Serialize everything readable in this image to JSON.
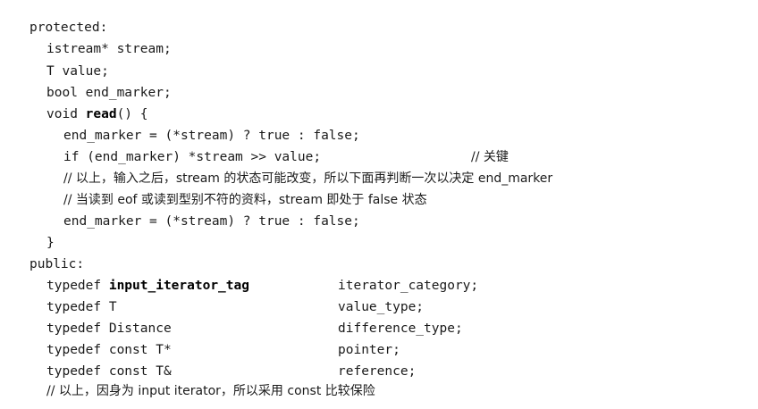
{
  "code": {
    "l01": "protected:",
    "l02": "istream* stream;",
    "l03": "T value;",
    "l04": "bool end_marker;",
    "l05_pre": "void ",
    "l05_bold": "read",
    "l05_post": "() {",
    "l06": "end_marker = (*stream) ? true : false;",
    "l07_code": "if (end_marker) *stream >> value;",
    "l07_comment": "// 关键",
    "l08": "// 以上，输入之后，stream 的状态可能改变，所以下面再判断一次以决定 end_marker",
    "l09": "// 当读到 eof 或读到型别不符的资料，stream 即处于 false 状态",
    "l10": "end_marker = (*stream) ? true : false;",
    "l11": "}",
    "l12": "public:",
    "l13_pre": "typedef ",
    "l13_bold": "input_iterator_tag",
    "l13_name": "iterator_category;",
    "l14_type": "typedef T",
    "l14_name": "value_type;",
    "l15_type": "typedef Distance",
    "l15_name": "difference_type;",
    "l16_type": "typedef const T*",
    "l16_name": "pointer;",
    "l17_type": "typedef const T&",
    "l17_name": "reference;",
    "l18": "// 以上，因身为 input iterator，所以采用 const 比较保险"
  }
}
